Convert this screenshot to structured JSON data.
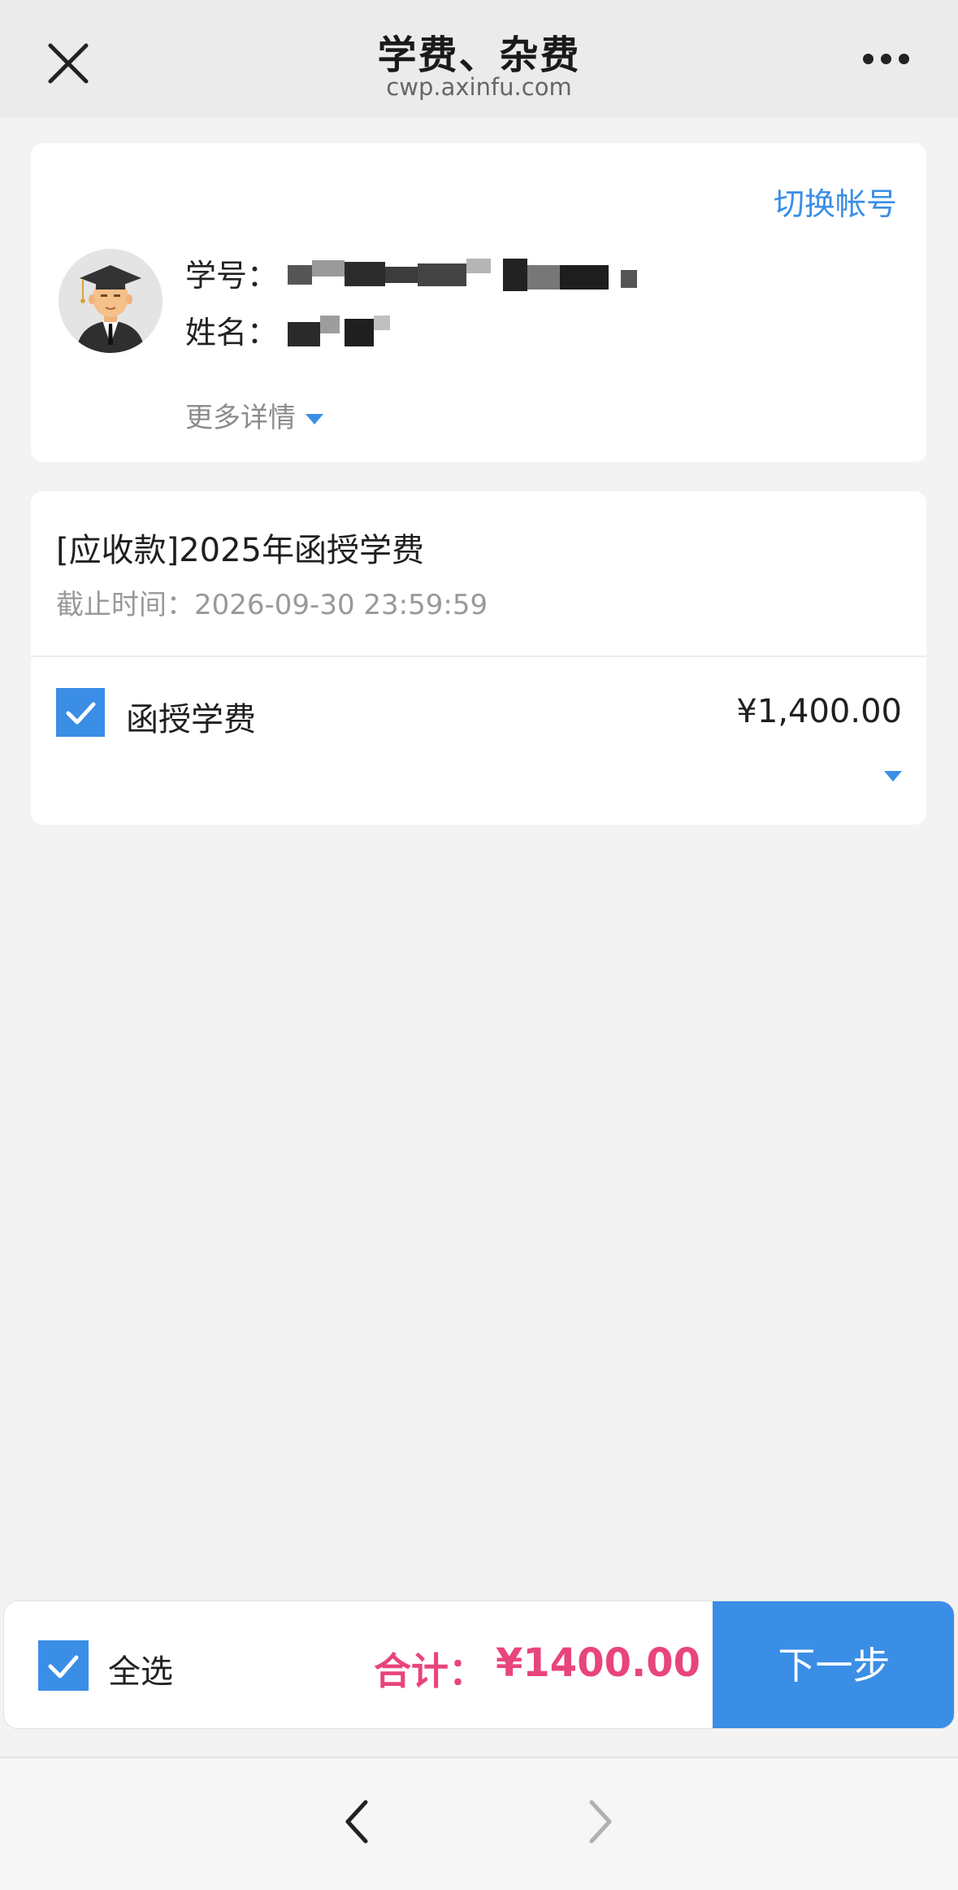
{
  "navbar": {
    "title": "学费、杂费",
    "subtitle": "cwp.axinfu.com",
    "close_icon": "close-icon",
    "more_icon": "more-dots-icon"
  },
  "account": {
    "switch_label": "切换帐号",
    "avatar_icon": "graduate-avatar-icon",
    "id_label": "学号：",
    "name_label": "姓名：",
    "more_details": "更多详情"
  },
  "bill": {
    "title": "[应收款]2025年函授学费",
    "deadline": "截止时间：2026-09-30 23:59:59",
    "items": [
      {
        "name": "函授学费",
        "amount": "¥1,400.00",
        "checked": true
      }
    ]
  },
  "action_bar": {
    "select_all": "全选",
    "total_label": "合计：",
    "total_amount": "¥1400.00",
    "next_label": "下一步",
    "checked": true
  },
  "colors": {
    "accent": "#3a8ee6",
    "total": "#e8457a"
  }
}
